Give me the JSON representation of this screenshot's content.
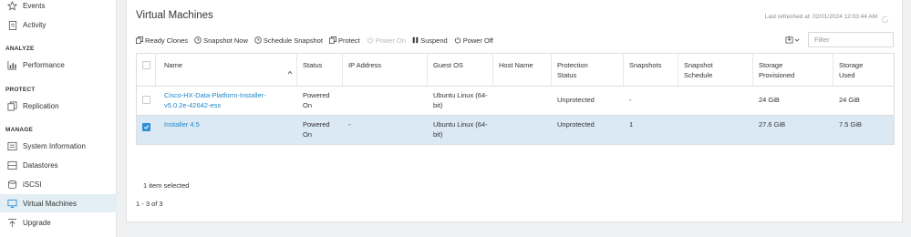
{
  "sidebar": {
    "items_top": [
      {
        "label": "Events",
        "icon": "star-icon"
      },
      {
        "label": "Activity",
        "icon": "clipboard-icon"
      }
    ],
    "sections": [
      {
        "header": "ANALYZE",
        "items": [
          {
            "label": "Performance",
            "icon": "bar-chart-icon"
          }
        ]
      },
      {
        "header": "PROTECT",
        "items": [
          {
            "label": "Replication",
            "icon": "replication-icon"
          }
        ]
      },
      {
        "header": "MANAGE",
        "items": [
          {
            "label": "System Information",
            "icon": "system-info-icon"
          },
          {
            "label": "Datastores",
            "icon": "datastore-icon"
          },
          {
            "label": "iSCSI",
            "icon": "iscsi-icon"
          },
          {
            "label": "Virtual Machines",
            "icon": "monitor-icon",
            "active": true
          },
          {
            "label": "Upgrade",
            "icon": "upgrade-icon"
          }
        ]
      }
    ]
  },
  "main": {
    "title": "Virtual Machines",
    "last_refreshed": "Last refreshed at: 02/01/2024 12:03:44 AM",
    "toolbar": {
      "ready_clones": "Ready Clones",
      "snapshot_now": "Snapshot Now",
      "schedule_snapshot": "Schedule Snapshot",
      "protect": "Protect",
      "power_on": "Power On",
      "suspend": "Suspend",
      "power_off": "Power Off"
    },
    "filter_placeholder": "Filter",
    "columns": {
      "name": "Name",
      "status": "Status",
      "ip": "IP Address",
      "guest_os": "Guest OS",
      "host": "Host Name",
      "protection": "Protection Status",
      "snapshots": "Snapshots",
      "schedule": "Snapshot Schedule",
      "provisioned": "Storage Provisioned",
      "used": "Storage Used"
    },
    "rows": [
      {
        "name": "Cisco-HX-Data-Platform-Installer-v5.0.2e-42642-esx",
        "status": "Powered On",
        "ip": "",
        "guest_os": "Ubuntu Linux (64-bit)",
        "host": "",
        "protection": "Unprotected",
        "snapshots": "-",
        "schedule": "",
        "provisioned": "24 GiB",
        "used": "24 GiB",
        "selected": false
      },
      {
        "name": "Installer 4.5",
        "status": "Powered On",
        "ip": "-",
        "guest_os": "Ubuntu Linux (64-bit)",
        "host": "",
        "protection": "Unprotected",
        "snapshots": "1",
        "schedule": "",
        "provisioned": "27.6 GiB",
        "used": "7.5 GiB",
        "selected": true
      }
    ],
    "selection_text": "1 item selected",
    "pagination": "1 - 3 of 3"
  },
  "colors": {
    "accent": "#1f87c8",
    "selected_row": "#dbe9f5",
    "active_nav": "#e4eef5"
  }
}
